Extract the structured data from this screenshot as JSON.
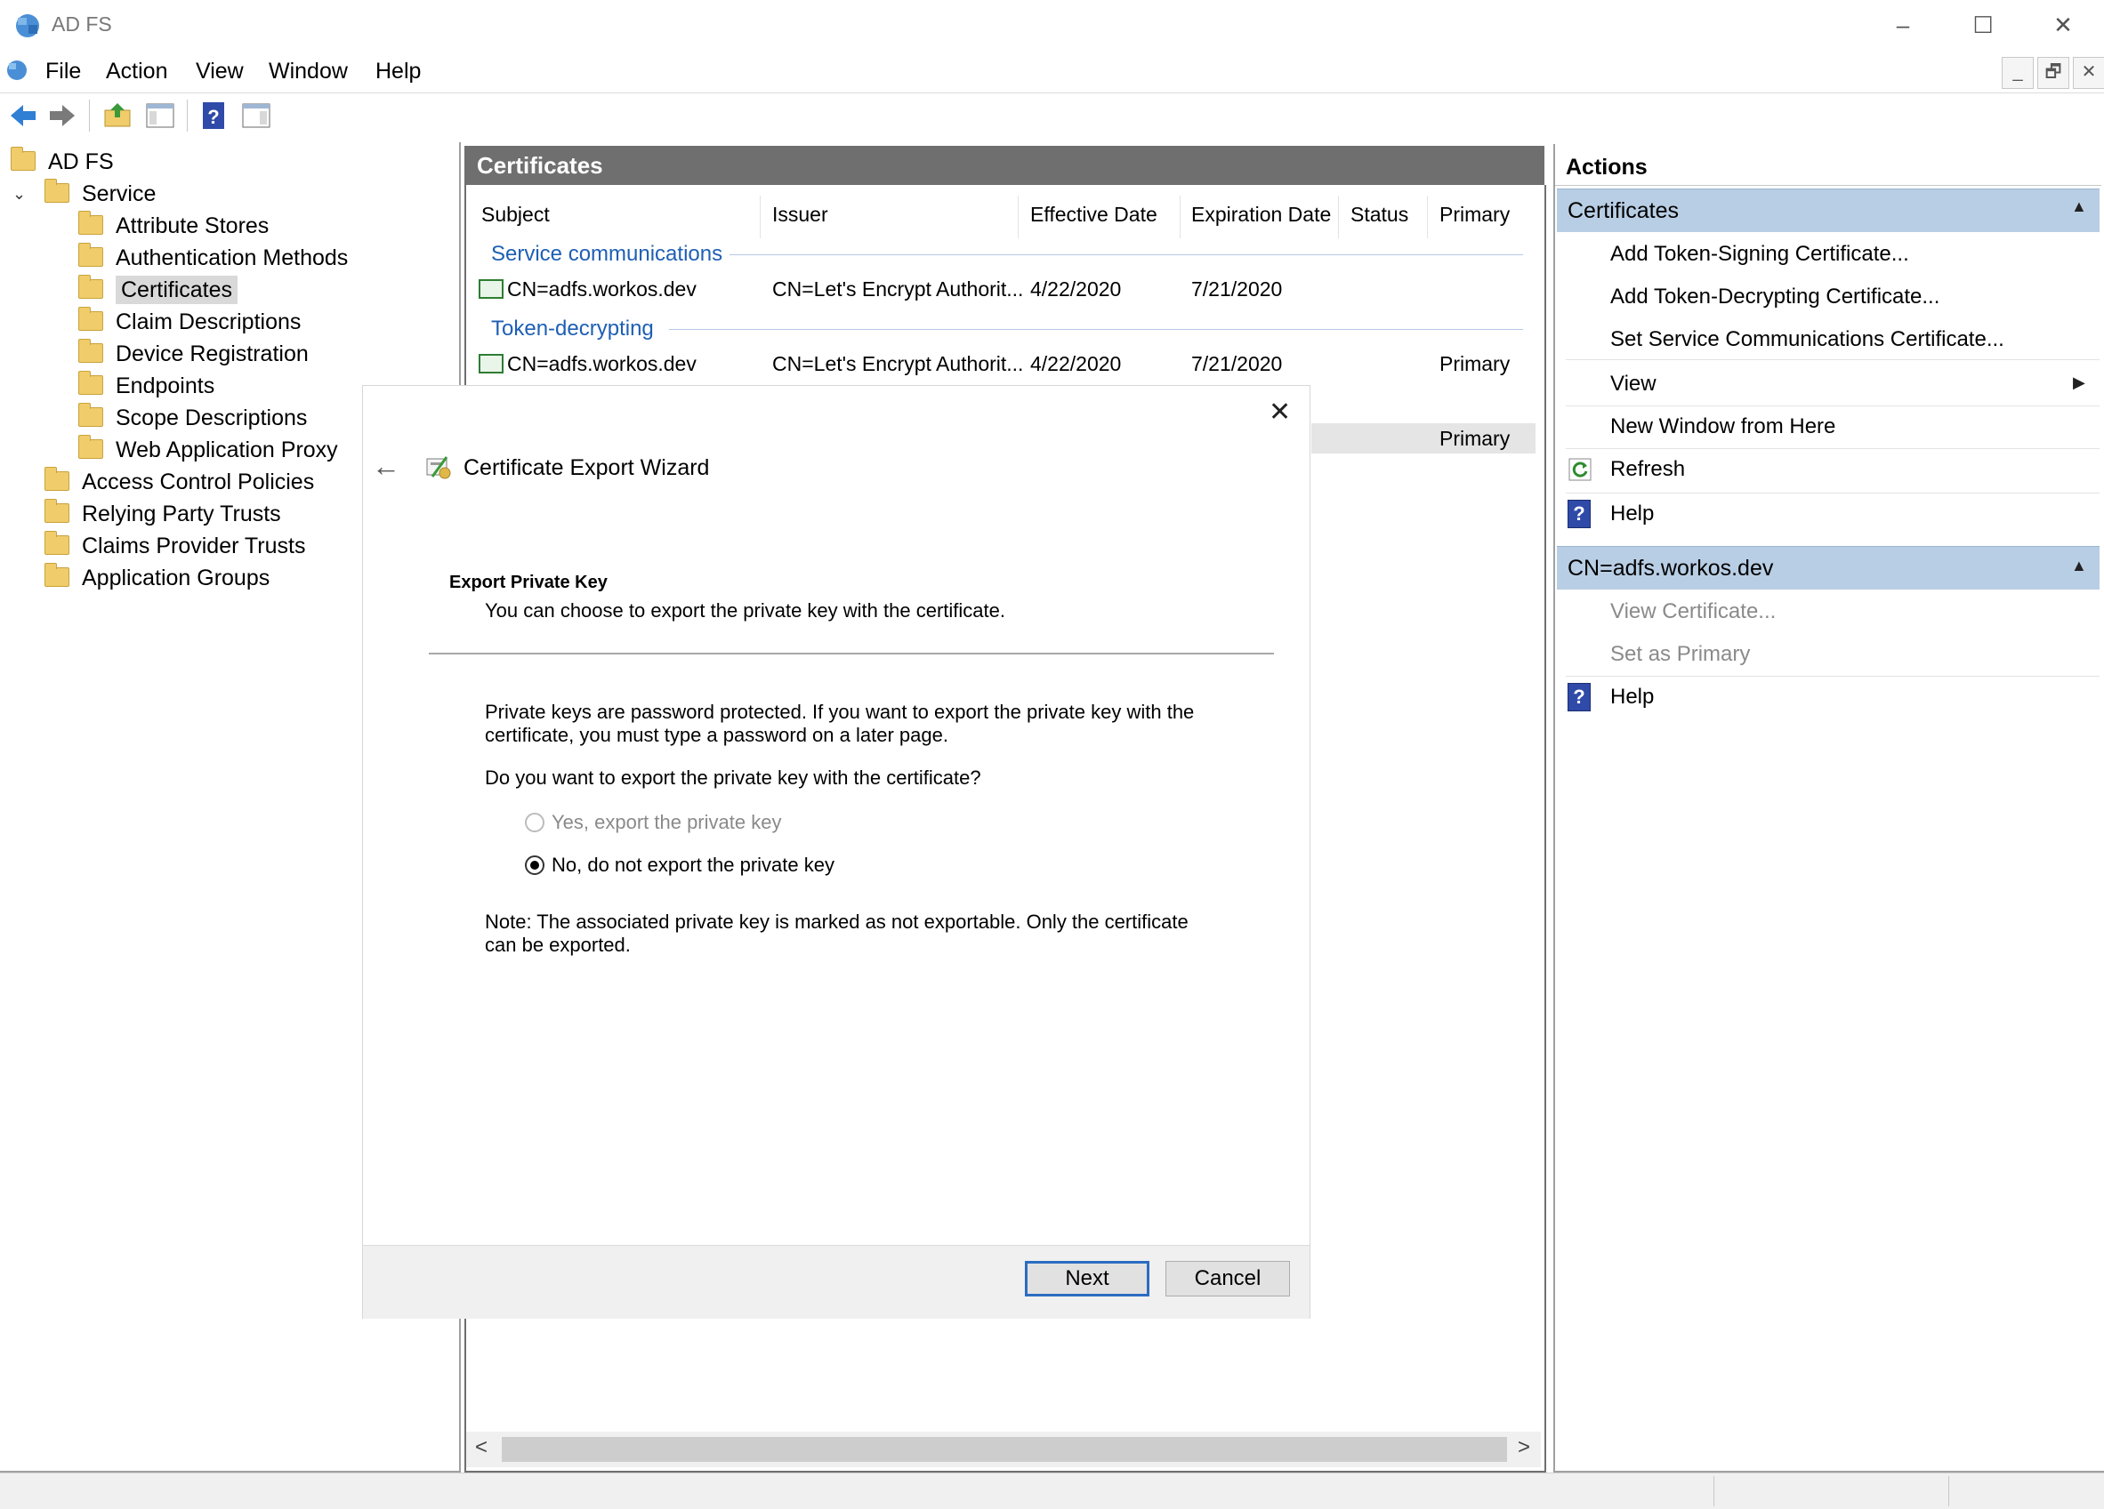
{
  "window": {
    "title": "AD FS",
    "minimize": "–",
    "maximize": "☐",
    "close": "✕"
  },
  "menu": [
    "File",
    "Action",
    "View",
    "Window",
    "Help"
  ],
  "mdi": {
    "minimize": "_",
    "restore": "🗗",
    "close": "✕"
  },
  "tree": {
    "root": "AD FS",
    "service": "Service",
    "service_children": [
      "Attribute Stores",
      "Authentication Methods",
      "Certificates",
      "Claim Descriptions",
      "Device Registration",
      "Endpoints",
      "Scope Descriptions",
      "Web Application Proxy"
    ],
    "top_items": [
      "Access Control Policies",
      "Relying Party Trusts",
      "Claims Provider Trusts",
      "Application Groups"
    ],
    "selected": "Certificates"
  },
  "center": {
    "title": "Certificates",
    "columns": [
      "Subject",
      "Issuer",
      "Effective Date",
      "Expiration Date",
      "Status",
      "Primary"
    ],
    "groups": [
      {
        "name": "Service communications",
        "rows": [
          {
            "subject": "CN=adfs.workos.dev",
            "issuer": "CN=Let's Encrypt Authorit...",
            "effective": "4/22/2020",
            "expiration": "7/21/2020",
            "status": "",
            "primary": ""
          }
        ]
      },
      {
        "name": "Token-decrypting",
        "rows": [
          {
            "subject": "CN=adfs.workos.dev",
            "issuer": "CN=Let's Encrypt Authorit...",
            "effective": "4/22/2020",
            "expiration": "7/21/2020",
            "status": "",
            "primary": "Primary"
          }
        ]
      }
    ],
    "partial_row_primary": "Primary",
    "scroll_left": "<",
    "scroll_right": ">"
  },
  "actions": {
    "title": "Actions",
    "section1": {
      "title": "Certificates",
      "items": [
        "Add Token-Signing Certificate...",
        "Add Token-Decrypting Certificate...",
        "Set Service Communications Certificate...",
        "View",
        "New Window from Here",
        "Refresh",
        "Help"
      ]
    },
    "section2": {
      "title": "CN=adfs.workos.dev",
      "items": [
        "View Certificate...",
        "Set as Primary",
        "Help"
      ]
    }
  },
  "wizard": {
    "title": "Certificate Export Wizard",
    "close": "✕",
    "back": "←",
    "heading": "Export Private Key",
    "subheading": "You can choose to export the private key with the certificate.",
    "para1_line1": "Private keys are password protected. If you want to export the private key with the",
    "para1_line2": "certificate, you must type a password on a later page.",
    "question": "Do you want to export the private key with the certificate?",
    "option_yes": "Yes, export the private key",
    "option_no": "No, do not export the private key",
    "selected_option": "No, do not export the private key",
    "note_line1": "Note: The associated private key is marked as not exportable. Only the certificate",
    "note_line2": "can be exported.",
    "next": "Next",
    "cancel": "Cancel"
  },
  "colors": {
    "section_header": "#b8cee4",
    "center_header": "#6f6f6f",
    "group_title": "#1e5fb4",
    "default_button_border": "#2c6cc2"
  }
}
